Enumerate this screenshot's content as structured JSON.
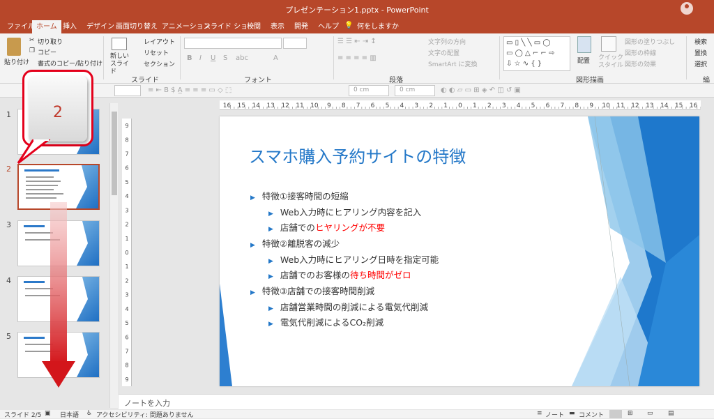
{
  "window": {
    "title": "プレゼンテーション1.pptx  -  PowerPoint"
  },
  "tabs": [
    "ファイル",
    "ホーム",
    "挿入",
    "デザイン",
    "画面切り替え",
    "アニメーション",
    "スライド ショー",
    "校閲",
    "表示",
    "開発",
    "ヘルプ",
    "何をしますか"
  ],
  "ribbon": {
    "paste": "貼り付け",
    "cut": "切り取り",
    "copy": "コピー",
    "format_painter": "書式のコピー/貼り付け",
    "new_slide": "新しい\nスライド",
    "layout": "レイアウト",
    "reset": "リセット",
    "section": "セクション",
    "groups": {
      "slides": "スライド",
      "font": "フォント",
      "paragraph": "段落",
      "drawing": "図形描画",
      "editing": "編集"
    },
    "text_direction": "文字列の方向",
    "align_text": "文字の配置",
    "smartart": "SmartArt に変換",
    "arrange": "配置",
    "quick_styles": "クイック\nスタイル",
    "shape_fill": "図形の塗りつぶし",
    "shape_outline": "図形の枠線",
    "shape_effects": "図形の効果",
    "find": "検索",
    "replace": "置換",
    "select": "選択"
  },
  "toolbar2": {
    "width1": "0 cm",
    "width2": "0 cm"
  },
  "ruler_labels": [
    "16",
    "15",
    "14",
    "13",
    "12",
    "11",
    "10",
    "9",
    "8",
    "7",
    "6",
    "5",
    "4",
    "3",
    "2",
    "1",
    "0",
    "1",
    "2",
    "3",
    "4",
    "5",
    "6",
    "7",
    "8",
    "9",
    "10",
    "11",
    "12",
    "13",
    "14",
    "15",
    "16"
  ],
  "thumbnails": [
    {
      "num": "1"
    },
    {
      "num": "2"
    },
    {
      "num": "3"
    },
    {
      "num": "4"
    },
    {
      "num": "5"
    }
  ],
  "callout": {
    "number": "2"
  },
  "slide": {
    "title": "スマホ購入予約サイトの特徴",
    "bullets": [
      {
        "level": 1,
        "text": "特徴①接客時間の短縮"
      },
      {
        "level": 2,
        "text": "Web入力時にヒアリング内容を記入"
      },
      {
        "level": 2,
        "text": "店舗での",
        "red": "ヒヤリングが不要"
      },
      {
        "level": 1,
        "text": "特徴②離脱客の減少"
      },
      {
        "level": 2,
        "text": "Web入力時にヒアリング日時を指定可能"
      },
      {
        "level": 2,
        "text": "店舗でのお客様の",
        "red": "待ち時間がゼロ"
      },
      {
        "level": 1,
        "text": "特徴③店舗での接客時間削減"
      },
      {
        "level": 2,
        "text": "店舗営業時間の削減による電気代削減"
      },
      {
        "level": 2,
        "text": "電気代削減によるCO₂削減"
      }
    ]
  },
  "notes": {
    "placeholder": "ノートを入力"
  },
  "status": {
    "slide": "スライド 2/5",
    "language": "日本語",
    "accessibility": "アクセシビリティ: 問題ありません",
    "notes": "ノート",
    "comments": "コメント"
  }
}
